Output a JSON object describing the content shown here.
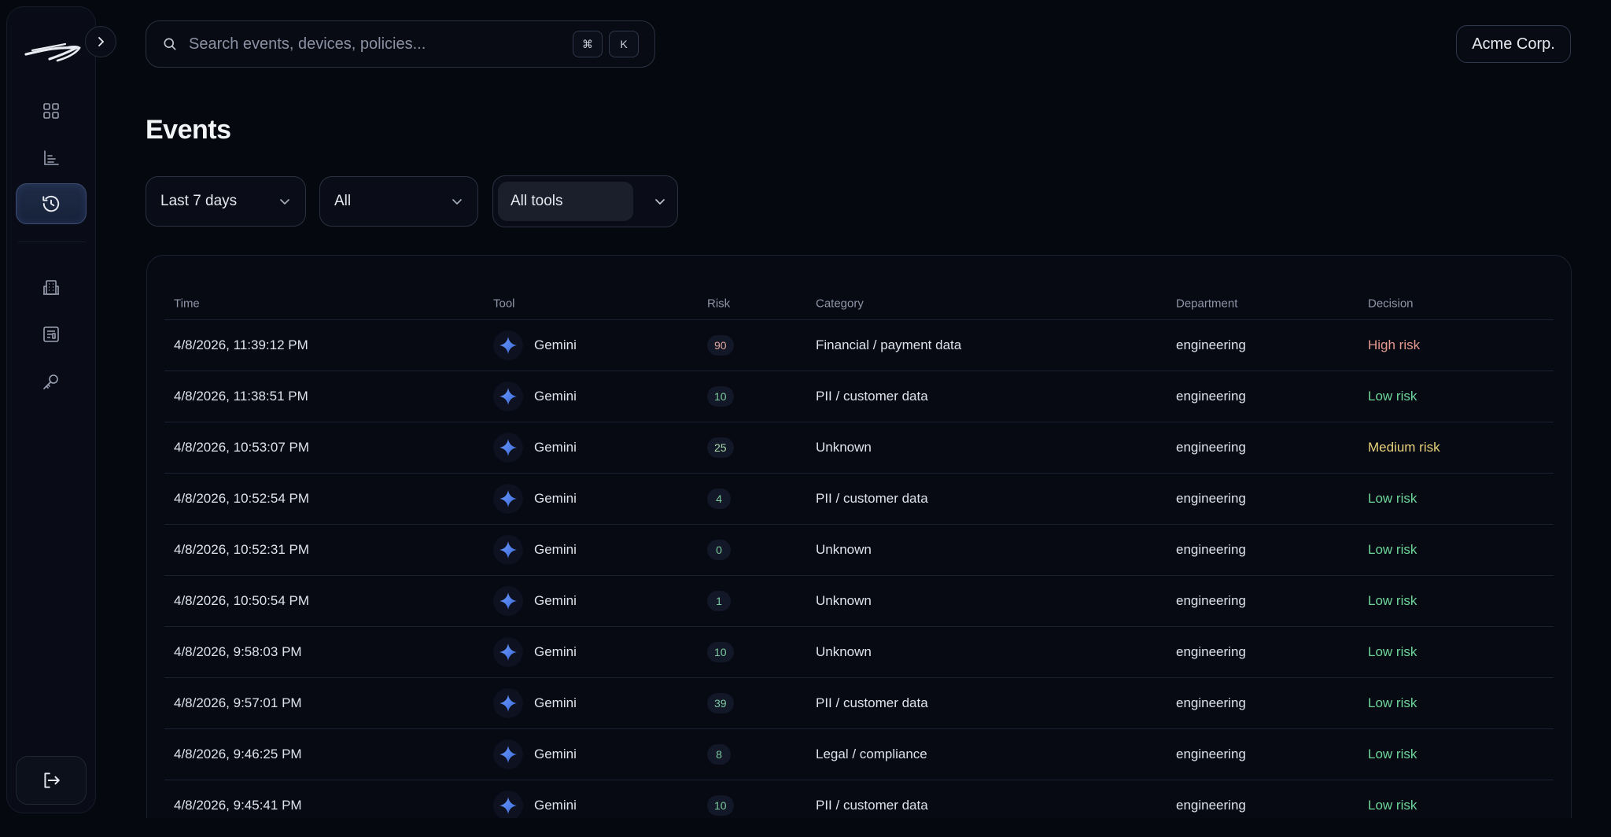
{
  "app": {
    "org_name": "Acme Corp."
  },
  "search": {
    "placeholder": "Search events, devices, policies...",
    "kbd_mod": "⌘",
    "kbd_key": "K"
  },
  "page": {
    "title": "Events"
  },
  "filters": {
    "range": "Last 7 days",
    "scope": "All",
    "tools": "All tools"
  },
  "table": {
    "columns": [
      "Time",
      "Tool",
      "Risk",
      "Category",
      "Department",
      "Decision"
    ],
    "rows": [
      {
        "time": "4/8/2026, 11:39:12 PM",
        "tool": "Gemini",
        "risk": "90",
        "category": "Financial / payment data",
        "department": "engineering",
        "decision": "High risk",
        "level": "high"
      },
      {
        "time": "4/8/2026, 11:38:51 PM",
        "tool": "Gemini",
        "risk": "10",
        "category": "PII / customer data",
        "department": "engineering",
        "decision": "Low risk",
        "level": "low"
      },
      {
        "time": "4/8/2026, 10:53:07 PM",
        "tool": "Gemini",
        "risk": "25",
        "category": "Unknown",
        "department": "engineering",
        "decision": "Medium risk",
        "level": "med"
      },
      {
        "time": "4/8/2026, 10:52:54 PM",
        "tool": "Gemini",
        "risk": "4",
        "category": "PII / customer data",
        "department": "engineering",
        "decision": "Low risk",
        "level": "low"
      },
      {
        "time": "4/8/2026, 10:52:31 PM",
        "tool": "Gemini",
        "risk": "0",
        "category": "Unknown",
        "department": "engineering",
        "decision": "Low risk",
        "level": "low"
      },
      {
        "time": "4/8/2026, 10:50:54 PM",
        "tool": "Gemini",
        "risk": "1",
        "category": "Unknown",
        "department": "engineering",
        "decision": "Low risk",
        "level": "low"
      },
      {
        "time": "4/8/2026, 9:58:03 PM",
        "tool": "Gemini",
        "risk": "10",
        "category": "Unknown",
        "department": "engineering",
        "decision": "Low risk",
        "level": "low"
      },
      {
        "time": "4/8/2026, 9:57:01 PM",
        "tool": "Gemini",
        "risk": "39",
        "category": "PII / customer data",
        "department": "engineering",
        "decision": "Low risk",
        "level": "low"
      },
      {
        "time": "4/8/2026, 9:46:25 PM",
        "tool": "Gemini",
        "risk": "8",
        "category": "Legal / compliance",
        "department": "engineering",
        "decision": "Low risk",
        "level": "low"
      },
      {
        "time": "4/8/2026, 9:45:41 PM",
        "tool": "Gemini",
        "risk": "10",
        "category": "PII / customer data",
        "department": "engineering",
        "decision": "Low risk",
        "level": "low"
      }
    ]
  },
  "colors": {
    "risk_high": "#e79a8f",
    "risk_low": "#6ed69a",
    "risk_med": "#e8d27a",
    "badge_high_text": "#e0a59a",
    "badge_low_text": "#7cc9a0",
    "badge_med_text": "#a8d9a8",
    "accent": "#4f7de8",
    "nav_active": "#1f2b45"
  },
  "icons": {
    "sidebar": [
      "logo-icon",
      "dashboard-grid-icon",
      "analytics-chart-icon",
      "history-icon",
      "building-icon",
      "report-icon",
      "key-icon",
      "logout-icon"
    ],
    "tool": "gemini-sparkle-icon"
  }
}
